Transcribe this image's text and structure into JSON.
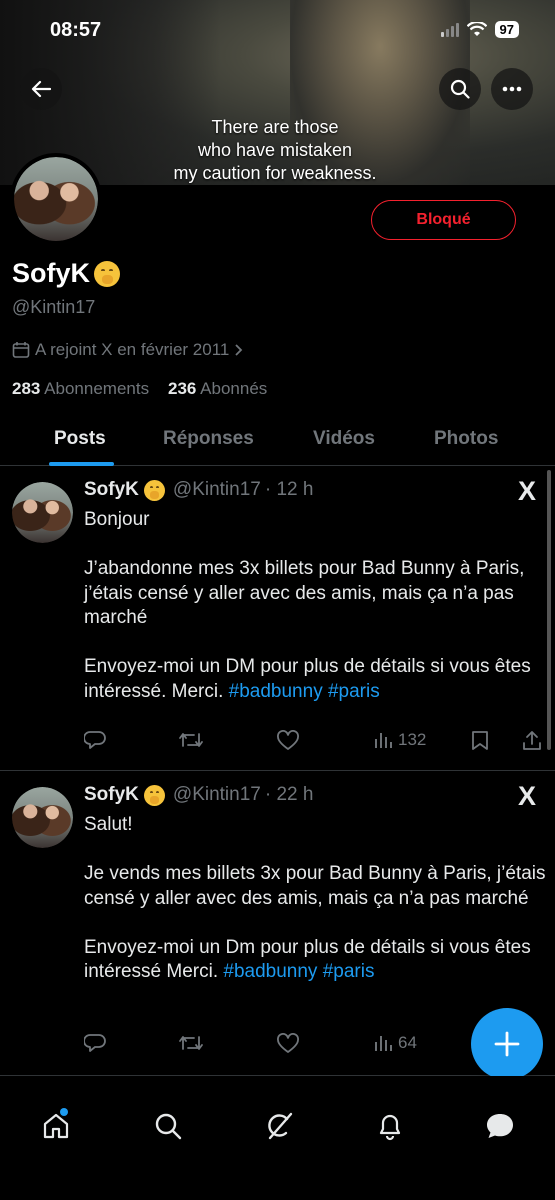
{
  "status_bar": {
    "time": "08:57",
    "battery": "97"
  },
  "banner": {
    "subtitle_lines": [
      "There are those",
      "who have mistaken",
      "my caution for weakness."
    ]
  },
  "profile": {
    "name": "SofyK",
    "handle": "@Kintin17",
    "joined": "A rejoint X en février 2011",
    "following_count": "283",
    "following_label": "Abonnements",
    "followers_count": "236",
    "followers_label": "Abonnés",
    "blocked_label": "Bloqué"
  },
  "tabs": [
    {
      "label": "Posts",
      "active": true
    },
    {
      "label": "Réponses",
      "active": false
    },
    {
      "label": "Vidéos",
      "active": false
    },
    {
      "label": "Photos",
      "active": false
    }
  ],
  "posts": [
    {
      "name": "SofyK",
      "handle": "@Kintin17",
      "time": "· 12 h",
      "lines": [
        "Bonjour",
        "",
        "J’abandonne mes 3x billets pour Bad Bunny à Paris, j’étais censé y aller avec des amis, mais ça n’a pas marché",
        "",
        "Envoyez-moi un DM pour plus de détails si vous êtes intéressé. Merci."
      ],
      "hashtags": [
        "#badbunny",
        "#paris"
      ],
      "views": "132"
    },
    {
      "name": "SofyK",
      "handle": "@Kintin17",
      "time": "· 22 h",
      "lines": [
        "Salut!",
        "",
        "Je vends mes billets 3x pour Bad Bunny à Paris, j’étais censé y aller avec des amis, mais ça n’a pas marché",
        "",
        "Envoyez-moi un Dm pour plus de détails si vous êtes intéressé Merci."
      ],
      "hashtags": [
        "#badbunny",
        "#paris"
      ],
      "views": "64"
    }
  ],
  "icons": {
    "back": "arrow-left-icon",
    "search": "search-icon",
    "more": "more-icon",
    "calendar": "calendar-icon",
    "x_logo": "X",
    "nav": [
      "home-icon",
      "search-icon",
      "grok-icon",
      "bell-icon",
      "messages-icon"
    ]
  },
  "colors": {
    "accent": "#1d9bf0",
    "blocked": "#f4212e",
    "muted": "#71767b",
    "text": "#e7e9ea"
  }
}
